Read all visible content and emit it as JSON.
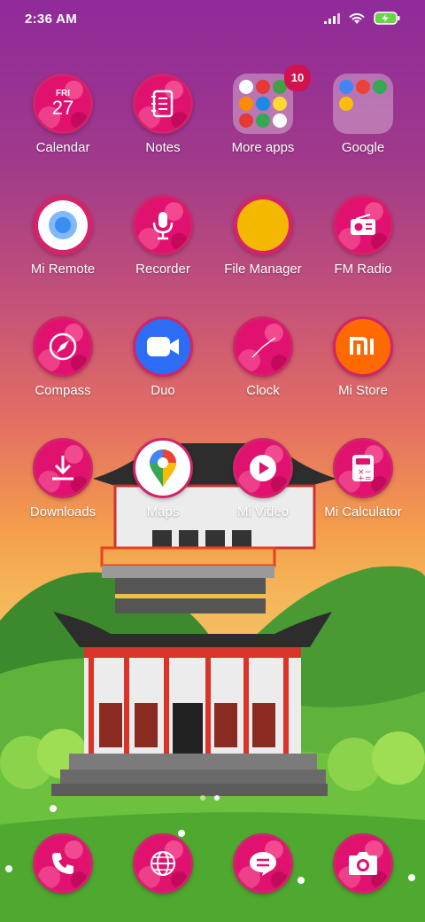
{
  "status_bar": {
    "time": "2:36 AM",
    "icons": [
      "signal-icon",
      "wifi-icon",
      "battery-charging-icon"
    ]
  },
  "apps": [
    {
      "id": "calendar",
      "label": "Calendar",
      "icon_day": "FRI",
      "icon_date": "27"
    },
    {
      "id": "notes",
      "label": "Notes"
    },
    {
      "id": "more-apps",
      "label": "More apps",
      "badge": "10"
    },
    {
      "id": "google",
      "label": "Google"
    },
    {
      "id": "mi-remote",
      "label": "Mi Remote"
    },
    {
      "id": "recorder",
      "label": "Recorder"
    },
    {
      "id": "file-manager",
      "label": "File Manager"
    },
    {
      "id": "fm-radio",
      "label": "FM Radio"
    },
    {
      "id": "compass",
      "label": "Compass"
    },
    {
      "id": "duo",
      "label": "Duo"
    },
    {
      "id": "clock",
      "label": "Clock"
    },
    {
      "id": "mi-store",
      "label": "Mi Store",
      "icon_text": "mi"
    },
    {
      "id": "downloads",
      "label": "Downloads"
    },
    {
      "id": "maps",
      "label": "Maps"
    },
    {
      "id": "mi-video",
      "label": "Mi Video"
    },
    {
      "id": "mi-calculator",
      "label": "Mi Calculator"
    }
  ],
  "dock": [
    {
      "id": "phone",
      "icon": "phone-icon"
    },
    {
      "id": "browser",
      "icon": "globe-icon"
    },
    {
      "id": "messaging",
      "icon": "message-icon"
    },
    {
      "id": "camera",
      "icon": "camera-icon"
    }
  ],
  "page_indicator": {
    "pages": 2,
    "current": 2
  },
  "colors": {
    "icon_pink": "#e0116f",
    "badge": "#d0124e",
    "mi_orange": "#ff6a00",
    "duo_blue": "#2d6cf4",
    "file_yellow": "#f5b800"
  }
}
